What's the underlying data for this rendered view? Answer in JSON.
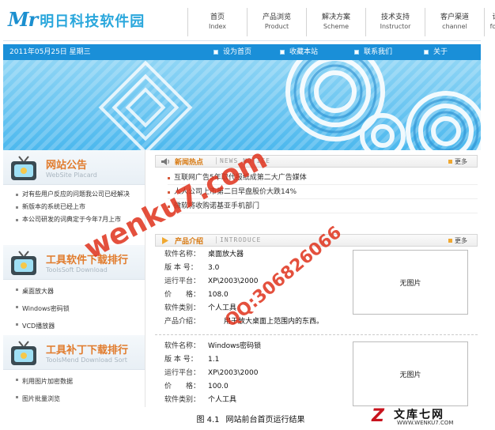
{
  "header": {
    "logo_mr": "Mr",
    "logo_name": "明日科技软件园",
    "nav": [
      {
        "cn": "首页",
        "en": "Index"
      },
      {
        "cn": "产品浏览",
        "en": "Product"
      },
      {
        "cn": "解决方案",
        "en": "Scheme"
      },
      {
        "cn": "技术支持",
        "en": "Instructor"
      },
      {
        "cn": "客户渠道",
        "en": "channel"
      },
      {
        "cn": "论坛",
        "en": "forum"
      }
    ]
  },
  "bar": {
    "date": "2011年05月25日 星期三",
    "links": [
      "设为首页",
      "收藏本站",
      "联系我们",
      "关于"
    ]
  },
  "sidebar": {
    "notice": {
      "title": "网站公告",
      "subtitle": "WebSite Placard",
      "items": [
        "对有些用户反应的问题我公司已经解决",
        "新版本的系统已经上市",
        "本公司研发的词典定于今年7月上市"
      ]
    },
    "tools": {
      "title": "工具软件下载排行",
      "subtitle": "ToolsSoft Download",
      "items": [
        "桌面放大器",
        "Windows密码锁",
        "VCD播放器"
      ]
    },
    "patches": {
      "title": "工具补丁下载排行",
      "subtitle": "ToolsMend Download Sort",
      "items": [
        "利用图片加密数据",
        "图片批量浏览"
      ]
    }
  },
  "news": {
    "title": "新闻热点",
    "en": "NEWS NOTICE",
    "more": "更多",
    "items": [
      "互联网广告5年取代报纸成第二大广告媒体",
      "人人公司上市第二日早盘股价大跌14%",
      "微软将收购诺基亚手机部门"
    ]
  },
  "products": {
    "title": "产品介绍",
    "en": "INTRODUCE",
    "more": "更多",
    "labels": {
      "name": "软件名称：",
      "version": "版 本 号：",
      "platform": "运行平台：",
      "price": "价　　格：",
      "category": "软件类别：",
      "intro": "产品介绍："
    },
    "no_image": "无图片",
    "list": [
      {
        "name": "桌面放大器",
        "version": "3.0",
        "platform": "XP\\2003\\2000",
        "price": "108.0",
        "category": "个人工具",
        "intro": "用于放大桌面上范围内的东西。"
      },
      {
        "name": "Windows密码锁",
        "version": "1.1",
        "platform": "XP\\2003\\2000",
        "price": "100.0",
        "category": "个人工具",
        "intro": ""
      }
    ]
  },
  "watermark": {
    "line1": "wenku7.com",
    "line2": "QQ:306826066"
  },
  "caption": {
    "fig": "图 4.1",
    "text": "网站前台首页运行结果"
  },
  "footer_logo": {
    "mark": "Z",
    "text": "文库七网",
    "url": "WWW.WENKU7.COM"
  }
}
